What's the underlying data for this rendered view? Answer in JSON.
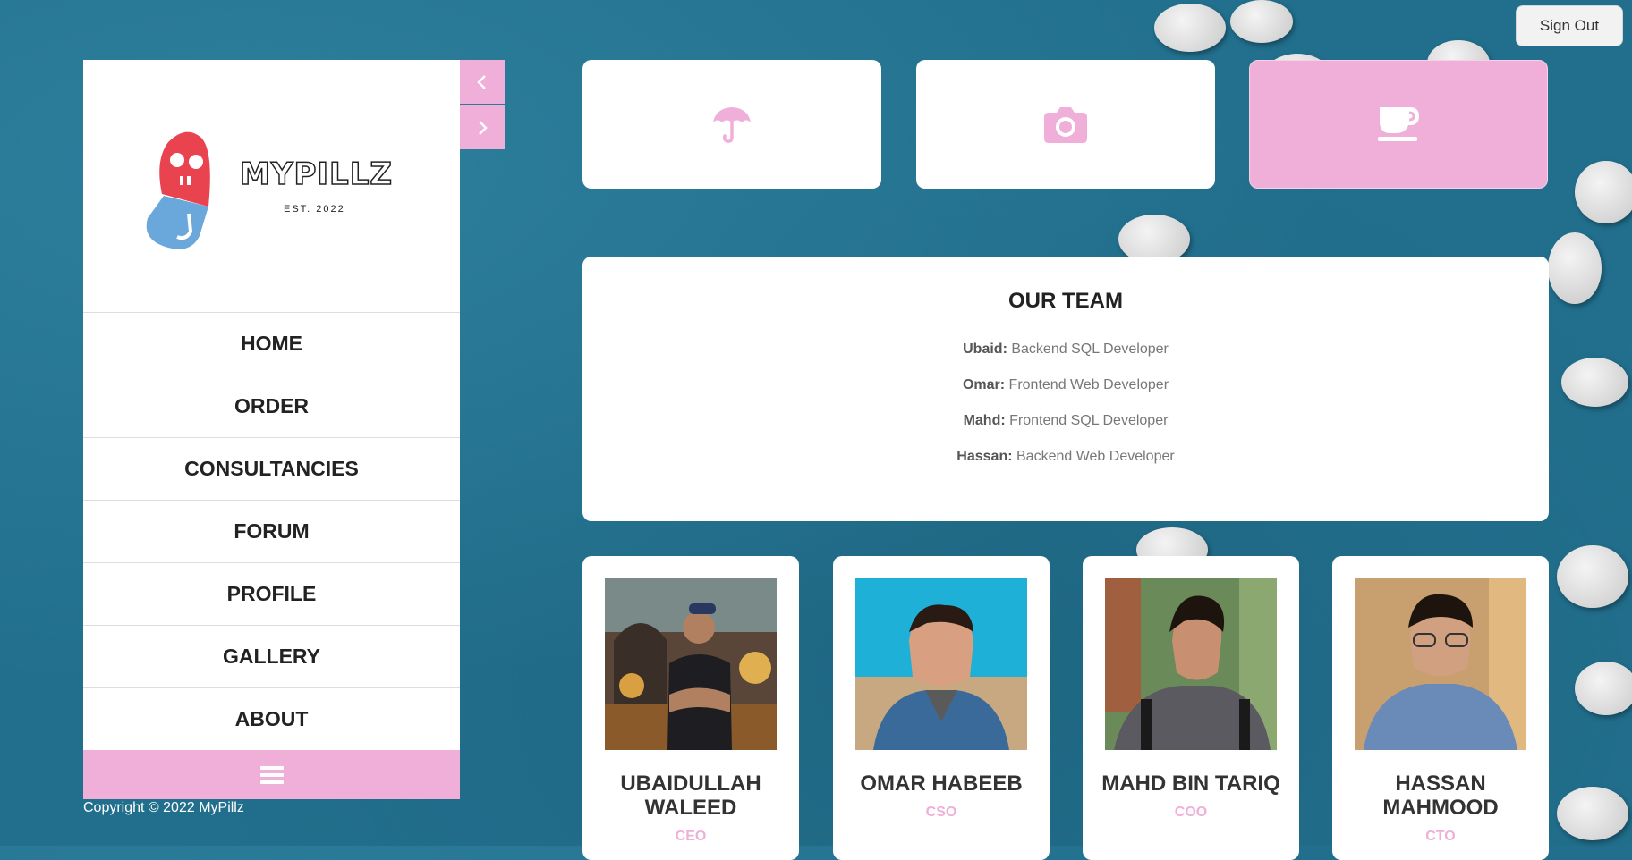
{
  "header": {
    "signout_label": "Sign Out"
  },
  "sidebar": {
    "logo": {
      "text": "MYPILLZ",
      "tagline": "EST. 2022"
    },
    "nav": [
      {
        "label": "HOME"
      },
      {
        "label": "ORDER"
      },
      {
        "label": "CONSULTANCIES"
      },
      {
        "label": "FORUM"
      },
      {
        "label": "PROFILE"
      },
      {
        "label": "GALLERY"
      },
      {
        "label": "ABOUT"
      }
    ],
    "collapse_icon": "chevron-left-icon",
    "expand_icon": "chevron-right-icon",
    "menu_icon": "hamburger-icon"
  },
  "footer": {
    "copyright": "Copyright © 2022 MyPillz"
  },
  "icon_cards": [
    {
      "icon": "umbrella-icon",
      "active": false
    },
    {
      "icon": "camera-icon",
      "active": false
    },
    {
      "icon": "coffee-cup-icon",
      "active": true
    }
  ],
  "team": {
    "title": "OUR TEAM",
    "roles": [
      {
        "name": "Ubaid:",
        "role": "Backend SQL Developer"
      },
      {
        "name": "Omar:",
        "role": "Frontend Web Developer"
      },
      {
        "name": "Mahd:",
        "role": "Frontend SQL Developer"
      },
      {
        "name": "Hassan:",
        "role": "Backend Web Developer"
      }
    ]
  },
  "members": [
    {
      "name": "UBAIDULLAH WALEED",
      "title": "CEO"
    },
    {
      "name": "OMAR HABEEB",
      "title": "CSO"
    },
    {
      "name": "MAHD BIN TARIQ",
      "title": "COO"
    },
    {
      "name": "HASSAN MAHMOOD",
      "title": "CTO"
    }
  ],
  "colors": {
    "accent": "#efafd9",
    "background": "#216f8d",
    "card": "#ffffff"
  }
}
